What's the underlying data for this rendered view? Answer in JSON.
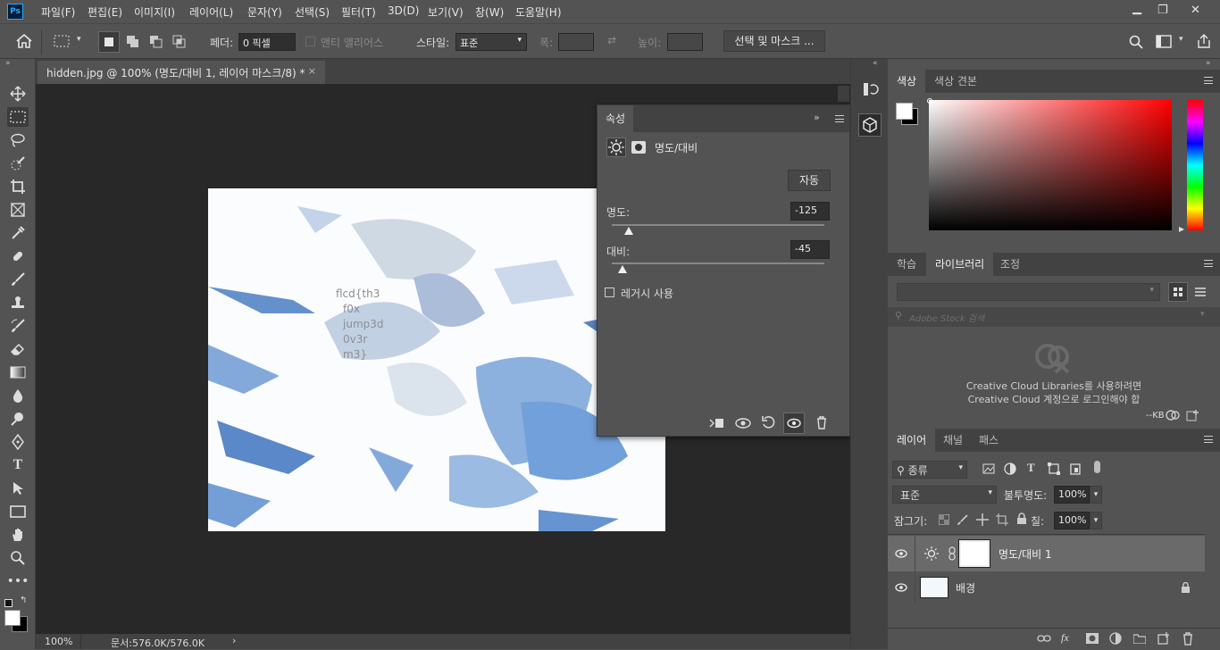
{
  "menubar": {
    "logo": "Ps",
    "items": [
      "파일(F)",
      "편집(E)",
      "이미지(I)",
      "레이어(L)",
      "문자(Y)",
      "선택(S)",
      "필터(T)",
      "3D(D)",
      "보기(V)",
      "창(W)",
      "도움말(H)"
    ]
  },
  "options": {
    "feather_label": "페더:",
    "feather_value": "0 픽셀",
    "antialias_label": "앤티 앨리어스",
    "style_label": "스타일:",
    "style_value": "표준",
    "width_label": "폭:",
    "height_label": "높이:",
    "select_mask_button": "선택 및 마스크 ..."
  },
  "document": {
    "tab_title": "hidden.jpg @ 100% (명도/대비 1, 레이어 마스크/8) *",
    "zoom": "100%",
    "doc_info": "문서:576.0K/576.0K",
    "image_overlay_text": [
      "flcd{th3",
      "f0x",
      "jump3d",
      "0v3r",
      "m3}"
    ]
  },
  "properties": {
    "tab": "속성",
    "title": "명도/대비",
    "auto_button": "자동",
    "brightness_label": "명도:",
    "brightness_value": "-125",
    "brightness_fraction": 0.08,
    "contrast_label": "대비:",
    "contrast_value": "-45",
    "contrast_fraction": 0.05,
    "legacy_label": "레거시 사용"
  },
  "color_panel": {
    "tabs": [
      "색상",
      "색상 견본"
    ],
    "hue_color": "#ff0000"
  },
  "library_panel": {
    "tabs": [
      "학습",
      "라이브러리",
      "조정"
    ],
    "search_placeholder": "Adobe Stock 검색",
    "message_line1": "Creative Cloud Libraries를 사용하려면",
    "message_line2": "Creative Cloud 계정으로 로그인해야 합",
    "footer_text": "--KB"
  },
  "layers_panel": {
    "tabs": [
      "레이어",
      "채널",
      "패스"
    ],
    "filter_value": "종류",
    "blend_mode": "표준",
    "opacity_label": "불투명도:",
    "opacity_value": "100%",
    "lock_label": "잠그기:",
    "fill_label": "칠:",
    "fill_value": "100%",
    "layers": [
      {
        "name": "명도/대비 1"
      },
      {
        "name": "배경"
      }
    ]
  },
  "colors": {
    "accent": "#31a8ff",
    "panel": "#535353",
    "canvas_bg": "#282828"
  }
}
